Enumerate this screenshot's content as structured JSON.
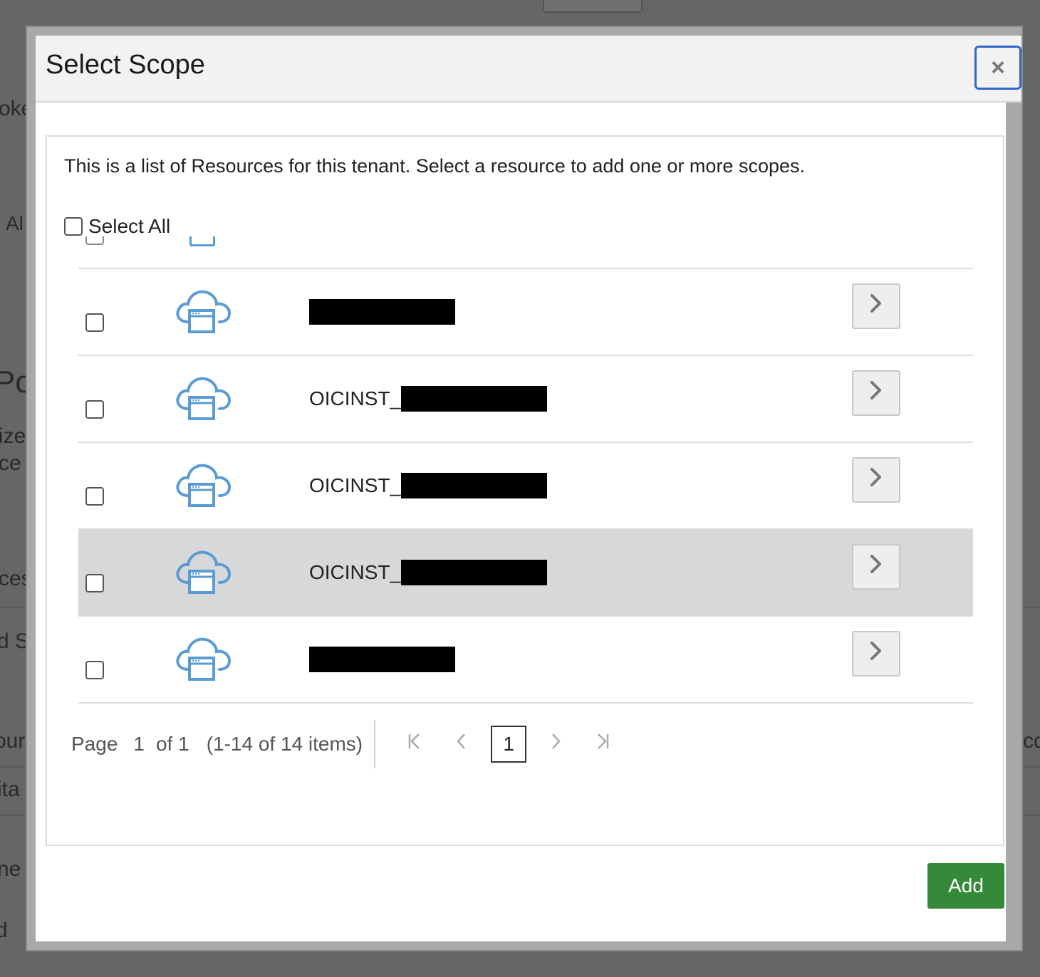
{
  "background": {
    "fragments": [
      "oke",
      "Al",
      "Po",
      "ize",
      "ce",
      "ces",
      "d S",
      "ourc",
      "co",
      "ita",
      "ne",
      "d"
    ]
  },
  "dialog": {
    "title": "Select Scope",
    "close_label": "×",
    "intro_text": "This is a list of Resources for this tenant. Select a resource to add one or more scopes.",
    "select_all_label": "Select All",
    "rows": [
      {
        "name_prefix": "",
        "redacted": true,
        "highlighted": false,
        "icon": "cloud-app-icon"
      },
      {
        "name_prefix": "OICINST_",
        "redacted": true,
        "highlighted": false,
        "icon": "cloud-app-icon"
      },
      {
        "name_prefix": "OICINST_",
        "redacted": true,
        "highlighted": false,
        "icon": "cloud-app-icon"
      },
      {
        "name_prefix": "OICINST_",
        "redacted": true,
        "highlighted": true,
        "icon": "cloud-app-icon"
      },
      {
        "name_prefix": "",
        "redacted": true,
        "highlighted": false,
        "icon": "cloud-app-icon"
      }
    ],
    "row_action_icon": "chevron-right-icon",
    "pagination": {
      "page_label": "Page",
      "current_page": "1",
      "of_label": "of 1",
      "items_label": "(1-14 of 14 items)",
      "first_icon": "first-page-icon",
      "prev_icon": "prev-page-icon",
      "next_icon": "next-page-icon",
      "last_icon": "last-page-icon"
    },
    "add_label": "Add"
  },
  "colors": {
    "overlay": "#666666",
    "accent_focus": "#3366cc",
    "add_button": "#348a3a",
    "icon_blue": "#5b9bd5",
    "row_highlight": "#d7d8da"
  }
}
